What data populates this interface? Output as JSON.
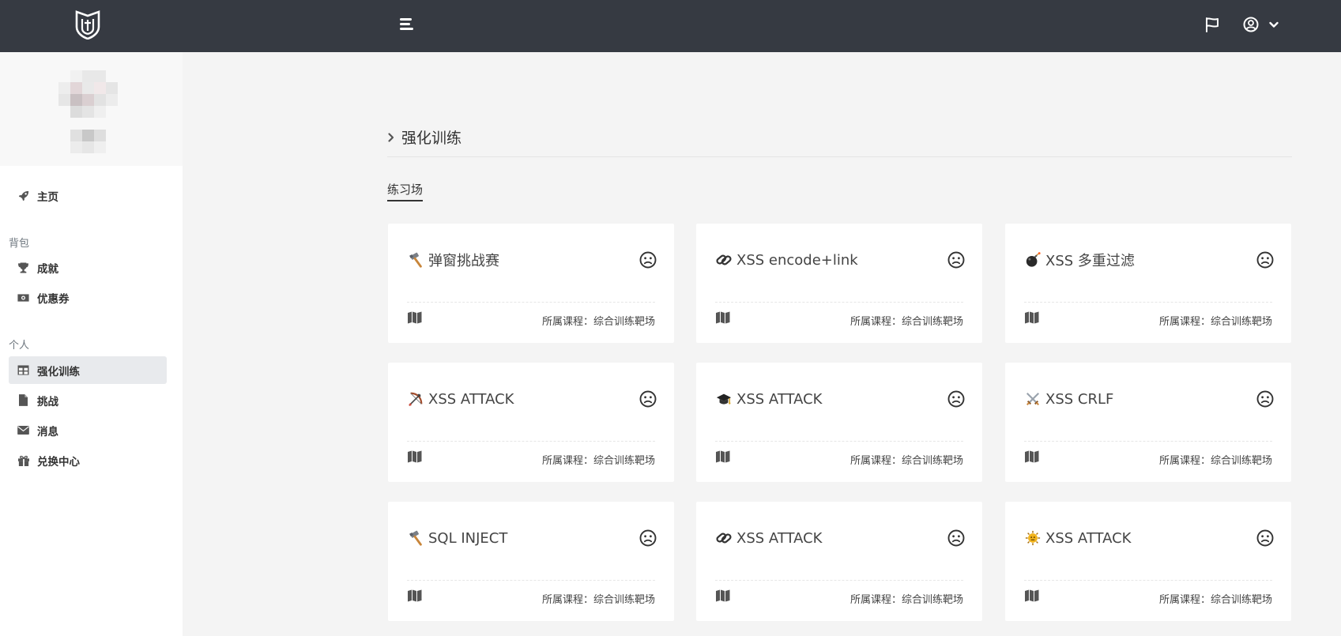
{
  "header": {
    "logo_icon": "shield-logo-icon",
    "menu_icon": "hamburger-icon",
    "flag_icon": "flag-icon",
    "user_icon": "user-circle-icon",
    "dropdown_icon": "chevron-down-icon"
  },
  "sidebar": {
    "home": "主页",
    "section_bag": "背包",
    "achievements": "成就",
    "coupons": "优惠券",
    "section_personal": "个人",
    "training": "强化训练",
    "challenge": "挑战",
    "messages": "消息",
    "exchange": "兑换中心"
  },
  "main": {
    "breadcrumb": "强化训练",
    "tab": "练习场",
    "course_prefix": "所属课程：",
    "cards": [
      {
        "emoji": "hammer-icon",
        "title": "弹窗挑战赛",
        "course": "所属课程：综合训练靶场"
      },
      {
        "emoji": "link-chain-icon",
        "title": "XSS encode+link",
        "course": "所属课程：综合训练靶场"
      },
      {
        "emoji": "bomb-icon",
        "title": "XSS 多重过滤",
        "course": "所属课程：综合训练靶场"
      },
      {
        "emoji": "bow-arrow-icon",
        "title": "XSS ATTACK",
        "course": "所属课程：综合训练靶场"
      },
      {
        "emoji": "graduation-cap-icon",
        "title": "XSS ATTACK",
        "course": "所属课程：综合训练靶场"
      },
      {
        "emoji": "crossed-swords-icon",
        "title": "XSS CRLF",
        "course": "所属课程：综合训练靶场"
      },
      {
        "emoji": "hammer-icon",
        "title": "SQL INJECT",
        "course": "所属课程：综合训练靶场"
      },
      {
        "emoji": "link-chain-icon",
        "title": "XSS ATTACK",
        "course": "所属课程：综合训练靶场"
      },
      {
        "emoji": "bug-icon",
        "title": "XSS ATTACK",
        "course": "所属课程：综合训练靶场"
      }
    ]
  }
}
